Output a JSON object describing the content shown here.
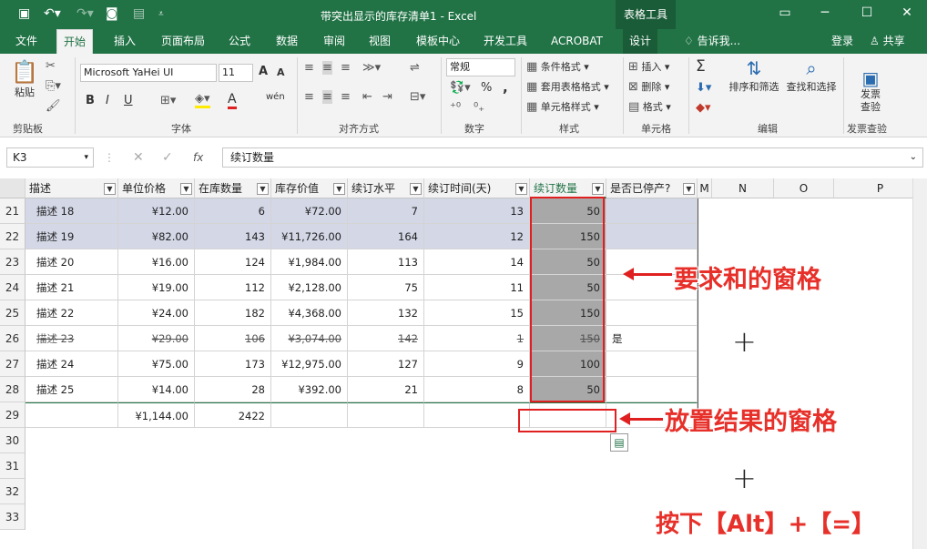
{
  "window": {
    "title": "带突出显示的库存清单1 - Excel",
    "tool_tab": "表格工具",
    "qat_icons": [
      "save-icon",
      "undo-icon",
      "redo-icon",
      "camera-icon",
      "sheet-icon",
      "customize-icon"
    ]
  },
  "tabs": [
    "文件",
    "开始",
    "插入",
    "页面布局",
    "公式",
    "数据",
    "审阅",
    "视图",
    "模板中心",
    "开发工具",
    "ACROBAT",
    "设计"
  ],
  "active_tab": "开始",
  "tell_me": "告诉我...",
  "login": "登录",
  "share": "共享",
  "ribbon": {
    "clipboard": {
      "paste": "粘贴",
      "group": "剪贴板"
    },
    "font": {
      "name": "Microsoft YaHei UI",
      "size": "11",
      "bold": "B",
      "italic": "I",
      "underline": "U",
      "grow": "A",
      "shrink": "A",
      "font_color": "A",
      "wen": "wén",
      "group": "字体"
    },
    "alignment": {
      "group": "对齐方式"
    },
    "number": {
      "format": "常规",
      "percent": "%",
      "comma": ",",
      "group": "数字"
    },
    "styles": {
      "conditional": "条件格式",
      "table": "套用表格格式",
      "cell": "单元格样式",
      "group": "样式"
    },
    "cells": {
      "insert": "插入",
      "delete": "删除",
      "format": "格式",
      "group": "单元格"
    },
    "editing": {
      "sum": "Σ",
      "sort": "排序和筛选",
      "find": "查找和选择",
      "group": "编辑"
    },
    "invoice": {
      "label": "发票\n查验",
      "group": "发票查验"
    }
  },
  "formula_bar": {
    "cell_ref": "K3",
    "fx": "fx",
    "content": "续订数量"
  },
  "columns": [
    {
      "label": "描述",
      "filter": true
    },
    {
      "label": "单位价格",
      "filter": true
    },
    {
      "label": "在库数量",
      "filter": true
    },
    {
      "label": "库存价值",
      "filter": true
    },
    {
      "label": "续订水平",
      "filter": true
    },
    {
      "label": "续订时间(天)",
      "filter": true
    },
    {
      "label": "续订数量",
      "filter": true
    },
    {
      "label": "是否已停产?",
      "filter": true
    }
  ],
  "extra_col_letters": [
    "M",
    "N",
    "O",
    "P"
  ],
  "rows": [
    {
      "num": "21",
      "cells": [
        "描述 18",
        "¥12.00",
        "6",
        "¥72.00",
        "7",
        "13",
        "50",
        ""
      ],
      "highlight": true,
      "strike": false
    },
    {
      "num": "22",
      "cells": [
        "描述 19",
        "¥82.00",
        "143",
        "¥11,726.00",
        "164",
        "12",
        "150",
        ""
      ],
      "highlight": true,
      "strike": false
    },
    {
      "num": "23",
      "cells": [
        "描述 20",
        "¥16.00",
        "124",
        "¥1,984.00",
        "113",
        "14",
        "50",
        ""
      ],
      "highlight": false,
      "strike": false
    },
    {
      "num": "24",
      "cells": [
        "描述 21",
        "¥19.00",
        "112",
        "¥2,128.00",
        "75",
        "11",
        "50",
        ""
      ],
      "highlight": false,
      "strike": false
    },
    {
      "num": "25",
      "cells": [
        "描述 22",
        "¥24.00",
        "182",
        "¥4,368.00",
        "132",
        "15",
        "150",
        ""
      ],
      "highlight": false,
      "strike": false
    },
    {
      "num": "26",
      "cells": [
        "描述 23",
        "¥29.00",
        "106",
        "¥3,074.00",
        "142",
        "1",
        "150",
        "是"
      ],
      "highlight": false,
      "strike": true
    },
    {
      "num": "27",
      "cells": [
        "描述 24",
        "¥75.00",
        "173",
        "¥12,975.00",
        "127",
        "9",
        "100",
        ""
      ],
      "highlight": false,
      "strike": false
    },
    {
      "num": "28",
      "cells": [
        "描述 25",
        "¥14.00",
        "28",
        "¥392.00",
        "21",
        "8",
        "50",
        ""
      ],
      "highlight": false,
      "strike": false
    },
    {
      "num": "29",
      "cells": [
        "",
        "¥1,144.00",
        "2422",
        "",
        "",
        "",
        "",
        ""
      ],
      "highlight": false,
      "strike": false,
      "total": true
    }
  ],
  "empty_rows": [
    "30",
    "31",
    "32",
    "33"
  ],
  "annotations": {
    "sum_cells": "要求和的窗格",
    "result_cell": "放置结果的窗格",
    "shortcut": "按下【Alt】+【=】"
  },
  "colors": {
    "excel_green": "#217346",
    "highlight_row": "#d3d7e6",
    "selected_col": "#a8a8a8",
    "annotation_red": "#e7302a"
  }
}
